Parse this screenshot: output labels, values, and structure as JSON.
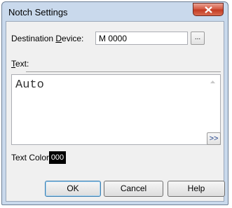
{
  "window": {
    "title": "Notch Settings"
  },
  "destination": {
    "label_pre": "Destination ",
    "label_u": "D",
    "label_post": "evice:",
    "value": "M 0000",
    "browse_label": "..."
  },
  "text_section": {
    "label_u": "T",
    "label_post": "ext:",
    "value": "Auto",
    "expand_label": ">>"
  },
  "text_color": {
    "label": "Text Color:",
    "value": "000",
    "color": "#000000"
  },
  "buttons": {
    "ok": "OK",
    "cancel": "Cancel",
    "help": "Help"
  },
  "icons": [
    "close-icon",
    "scroll-up-icon",
    "scroll-down-icon"
  ]
}
